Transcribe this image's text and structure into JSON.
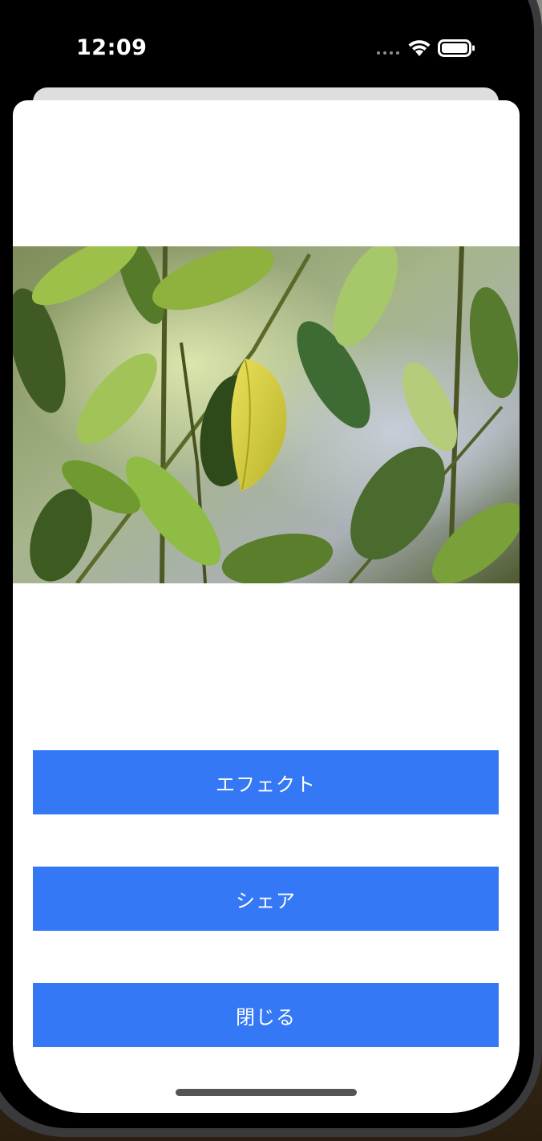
{
  "status_bar": {
    "time": "12:09",
    "icons": [
      "signal-dots-icon",
      "wifi-icon",
      "battery-icon"
    ]
  },
  "photo": {
    "icon": "leaf-photo"
  },
  "buttons": {
    "effect_label": "エフェクト",
    "share_label": "シェア",
    "close_label": "閉じる"
  },
  "colors": {
    "button_background": "#3478f6",
    "button_text": "#ffffff",
    "sheet_background": "#ffffff"
  }
}
